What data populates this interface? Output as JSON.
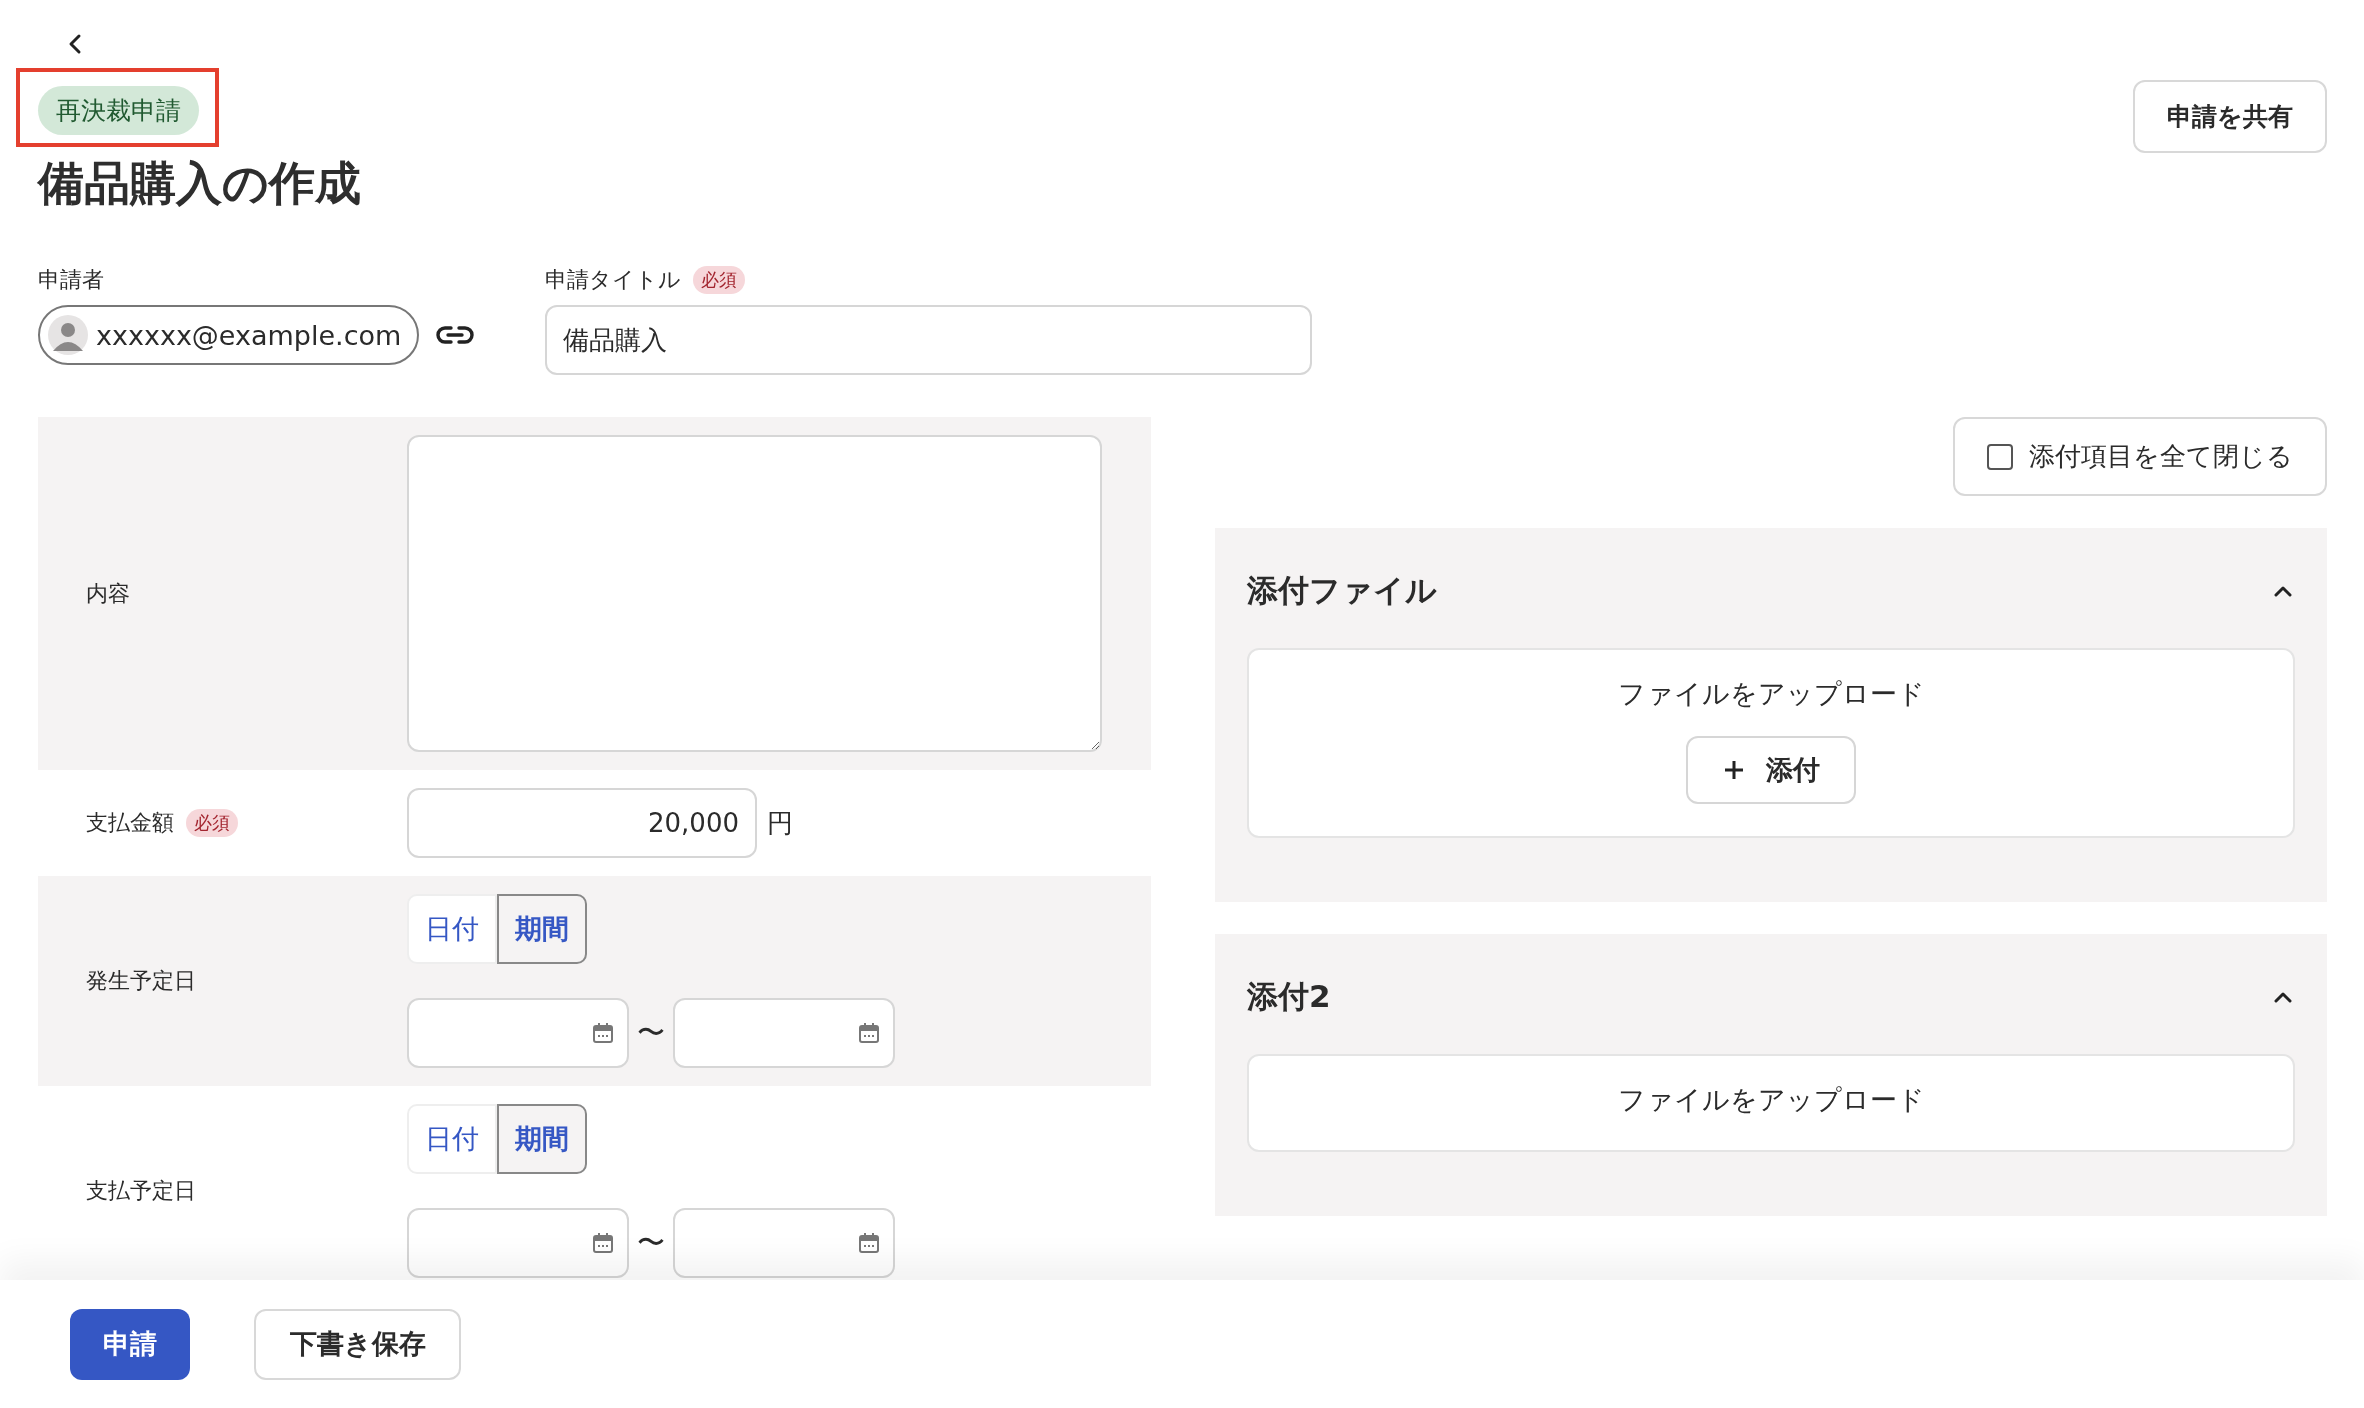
{
  "status_badge": {
    "label": "再決裁申請",
    "highlighted": true
  },
  "title": "備品購入の作成",
  "share_button": "申請を共有",
  "applicant": {
    "label": "申請者",
    "email": "xxxxxx@example.com"
  },
  "request_title": {
    "label": "申請タイトル",
    "required_badge": "必須",
    "value": "備品購入"
  },
  "form_rows": [
    {
      "kind": "textarea",
      "label": "内容"
    },
    {
      "kind": "amount",
      "label": "支払金額",
      "required_badge": "必須",
      "value": "20,000",
      "unit": "円"
    },
    {
      "kind": "date_range",
      "label": "発生予定日",
      "modes": [
        {
          "label": "日付",
          "selected": false
        },
        {
          "label": "期間",
          "selected": true
        }
      ],
      "separator": "〜"
    },
    {
      "kind": "date_range",
      "label": "支払予定日",
      "modes": [
        {
          "label": "日付",
          "selected": false
        },
        {
          "label": "期間",
          "selected": true
        }
      ],
      "separator": "〜"
    }
  ],
  "collapse_all": {
    "label": "添付項目を全て閉じる",
    "checked": false
  },
  "attachments": [
    {
      "title": "添付ファイル",
      "expanded": true,
      "upload_text": "ファイルをアップロード",
      "add_button": "添付"
    },
    {
      "title": "添付2",
      "expanded": true,
      "upload_text": "ファイルをアップロード"
    }
  ],
  "footer_buttons": [
    {
      "label": "申請",
      "kind": "primary"
    },
    {
      "label": "下書き保存",
      "kind": "secondary"
    }
  ]
}
